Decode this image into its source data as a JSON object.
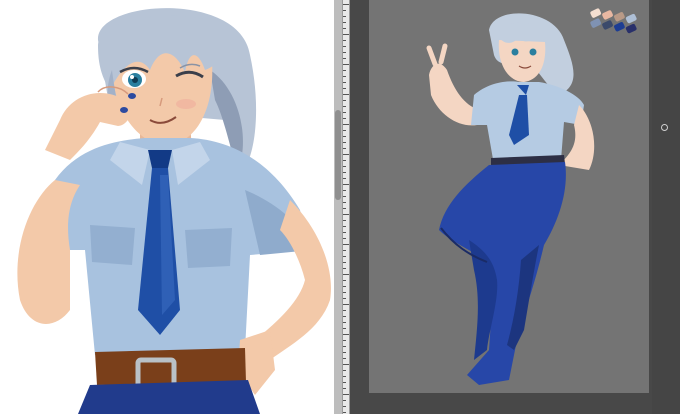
{
  "colors": {
    "app_background": "#4a4a4a",
    "left_canvas": "#ffffff",
    "right_canvas": "#747474",
    "skin": "#f3c9a9",
    "hair": "#b7c4d6",
    "hair_shadow": "#8e9db5",
    "shirt": "#a8c2df",
    "shirt_shadow": "#7f9dc1",
    "tie": "#1f4fa6",
    "tie_dark": "#123a86",
    "pants": "#213b8c",
    "pants_sketch": "#2747a8",
    "belt": "#7a3f1a",
    "buckle": "#b9c1c7",
    "eye": "#2a7f9f"
  },
  "palette_swatches": [
    "#f4ded0",
    "#e9b8a2",
    "#b99a87",
    "#aebfd6",
    "#7f92b3",
    "#3b4a6b",
    "#1d3d93",
    "#29306a"
  ],
  "icons": {
    "collapse_handle": "circle-handle-icon"
  }
}
